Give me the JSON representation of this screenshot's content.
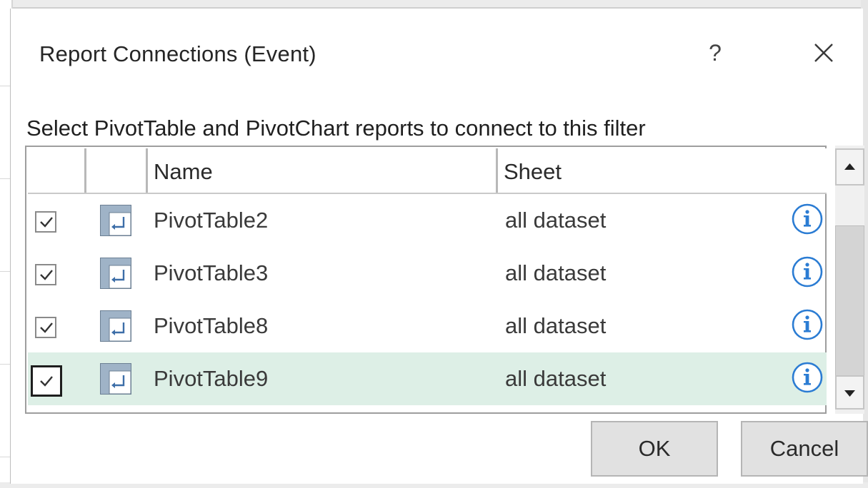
{
  "dialog": {
    "title": "Report Connections (Event)",
    "help_label": "?",
    "close_icon": "close-icon",
    "instruction": "Select PivotTable and PivotChart reports to connect to this filter"
  },
  "table": {
    "columns": {
      "name": "Name",
      "sheet": "Sheet"
    },
    "rows": [
      {
        "checked": true,
        "name": "PivotTable2",
        "sheet": "all dataset",
        "selected": false
      },
      {
        "checked": true,
        "name": "PivotTable3",
        "sheet": "all dataset",
        "selected": false
      },
      {
        "checked": true,
        "name": "PivotTable8",
        "sheet": "all dataset",
        "selected": false
      },
      {
        "checked": true,
        "name": "PivotTable9",
        "sheet": "all dataset",
        "selected": true
      }
    ]
  },
  "buttons": {
    "ok": "OK",
    "cancel": "Cancel"
  },
  "colors": {
    "selected_row": "#ddefe6",
    "info_accent": "#2b7cd3"
  }
}
